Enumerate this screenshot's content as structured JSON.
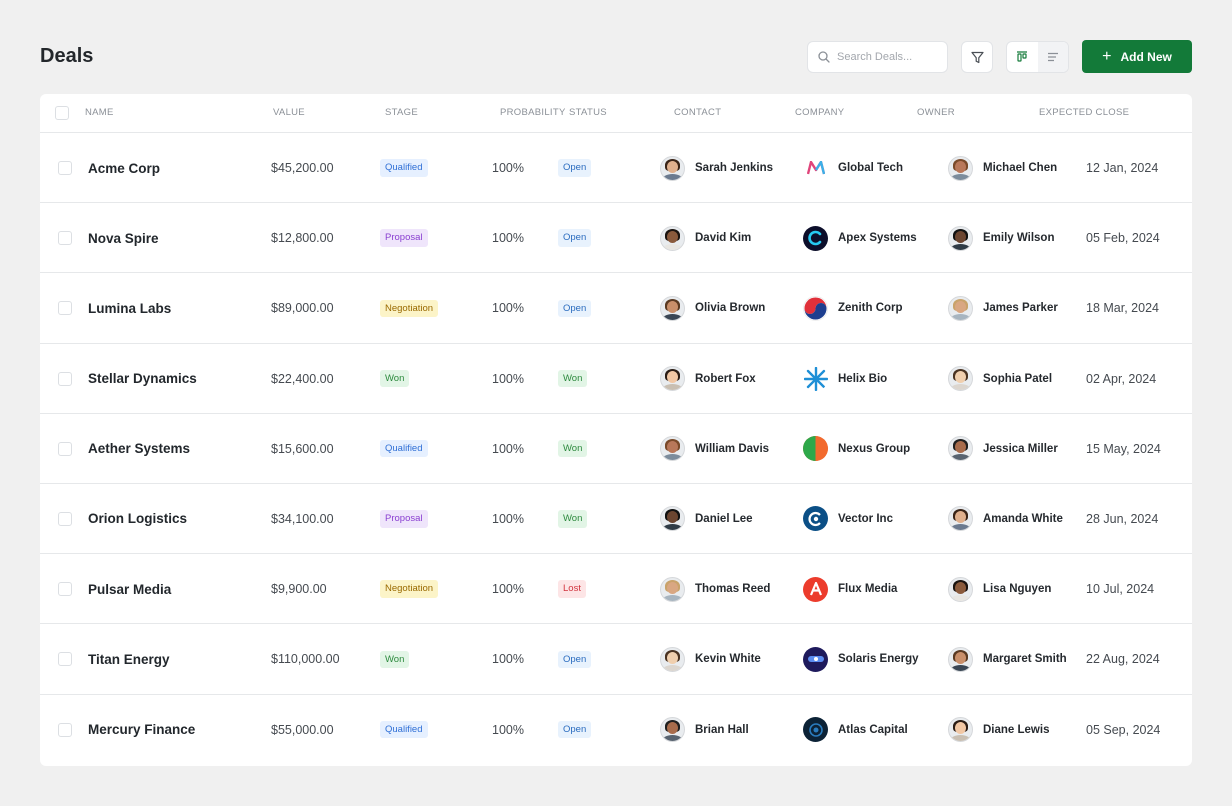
{
  "page": {
    "title": "Deals"
  },
  "toolbar": {
    "search_placeholder": "Search Deals...",
    "add_label": "Add New",
    "accent": "#137a39"
  },
  "columns": [
    "Name",
    "Value",
    "Stage",
    "Probability",
    "Status",
    "Contact",
    "Company",
    "Owner",
    "Expected Close"
  ],
  "rows": [
    {
      "name": "Acme Corp",
      "value": "$45,200.00",
      "stage": "Qualified",
      "probability": "100%",
      "status": "Open",
      "contact": "Sarah Jenkins",
      "company": "Global Tech",
      "owner": "Michael Chen",
      "close": "12 Jan, 2024"
    },
    {
      "name": "Nova Spire",
      "value": "$12,800.00",
      "stage": "Proposal",
      "probability": "100%",
      "status": "Open",
      "contact": "David Kim",
      "company": "Apex Systems",
      "owner": "Emily Wilson",
      "close": "05 Feb, 2024"
    },
    {
      "name": "Lumina Labs",
      "value": "$89,000.00",
      "stage": "Negotiation",
      "probability": "100%",
      "status": "Open",
      "contact": "Olivia Brown",
      "company": "Zenith Corp",
      "owner": "James Parker",
      "close": "18 Mar, 2024"
    },
    {
      "name": "Stellar Dynamics",
      "value": "$22,400.00",
      "stage": "Won",
      "probability": "100%",
      "status": "Won",
      "contact": "Robert Fox",
      "company": "Helix Bio",
      "owner": "Sophia Patel",
      "close": "02 Apr, 2024"
    },
    {
      "name": "Aether Systems",
      "value": "$15,600.00",
      "stage": "Qualified",
      "probability": "100%",
      "status": "Won",
      "contact": "William Davis",
      "company": "Nexus Group",
      "owner": "Jessica Miller",
      "close": "15 May, 2024"
    },
    {
      "name": "Orion Logistics",
      "value": "$34,100.00",
      "stage": "Proposal",
      "probability": "100%",
      "status": "Won",
      "contact": "Daniel Lee",
      "company": "Vector Inc",
      "owner": "Amanda White",
      "close": "28 Jun, 2024"
    },
    {
      "name": "Pulsar Media",
      "value": "$9,900.00",
      "stage": "Negotiation",
      "probability": "100%",
      "status": "Lost",
      "contact": "Thomas Reed",
      "company": "Flux Media",
      "owner": "Lisa Nguyen",
      "close": "10 Jul, 2024"
    },
    {
      "name": "Titan Energy",
      "value": "$110,000.00",
      "stage": "Won",
      "probability": "100%",
      "status": "Open",
      "contact": "Kevin White",
      "company": "Solaris Energy",
      "owner": "Margaret Smith",
      "close": "22 Aug, 2024"
    },
    {
      "name": "Mercury Finance",
      "value": "$55,000.00",
      "stage": "Qualified",
      "probability": "100%",
      "status": "Open",
      "contact": "Brian Hall",
      "company": "Atlas Capital",
      "owner": "Diane Lewis",
      "close": "05 Sep, 2024"
    }
  ]
}
